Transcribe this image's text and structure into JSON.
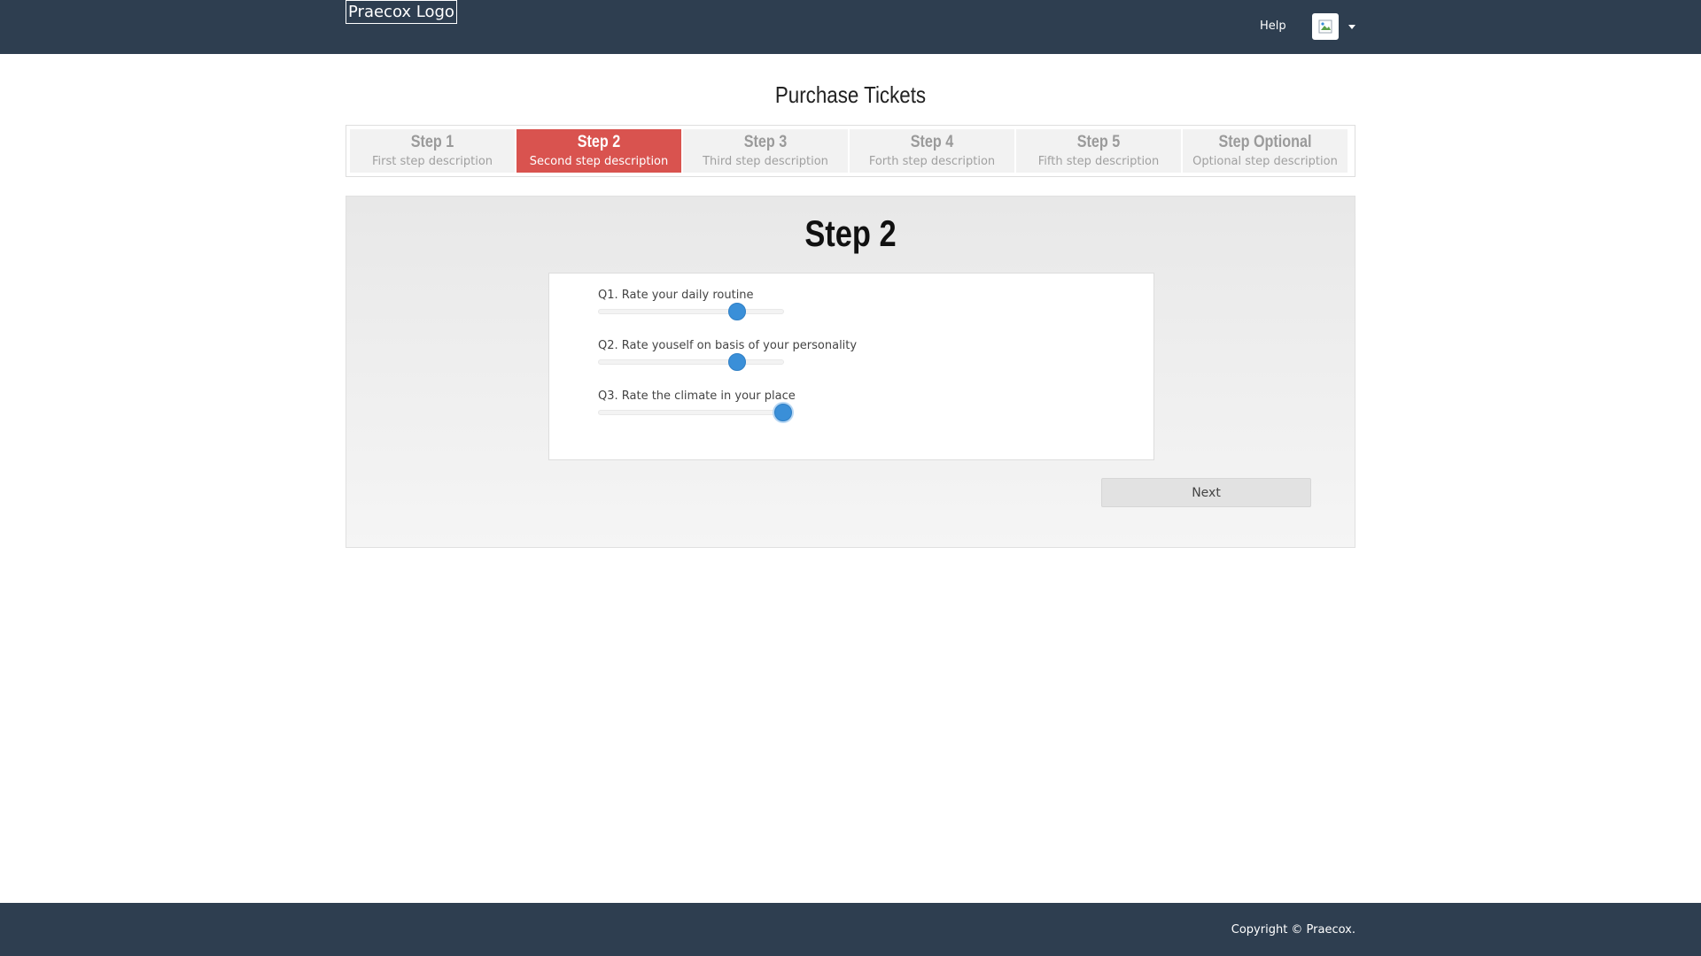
{
  "header": {
    "logo_text": "Praecox Logo",
    "help_label": "Help",
    "avatar_icon": "broken-image-icon",
    "menu_icon": "caret-down-icon"
  },
  "page": {
    "title": "Purchase Tickets"
  },
  "steps": [
    {
      "title": "Step 1",
      "description": "First step description",
      "active": false
    },
    {
      "title": "Step 2",
      "description": "Second step description",
      "active": true
    },
    {
      "title": "Step 3",
      "description": "Third step description",
      "active": false
    },
    {
      "title": "Step 4",
      "description": "Forth step description",
      "active": false
    },
    {
      "title": "Step 5",
      "description": "Fifth step description",
      "active": false
    },
    {
      "title": "Step Optional",
      "description": "Optional step description",
      "active": false
    }
  ],
  "panel": {
    "title": "Step 2",
    "questions": [
      {
        "label": "Q1. Rate your daily routine",
        "value_percent": 75
      },
      {
        "label": "Q2. Rate youself on basis of your personality",
        "value_percent": 75
      },
      {
        "label": "Q3. Rate the climate in your place",
        "value_percent": 100
      }
    ],
    "next_label": "Next"
  },
  "footer": {
    "copyright": "Copyright © Praecox."
  },
  "colors": {
    "header_bg": "#2e3e50",
    "active_step": "#d9534f",
    "slider_handle": "#3a8fd8"
  }
}
